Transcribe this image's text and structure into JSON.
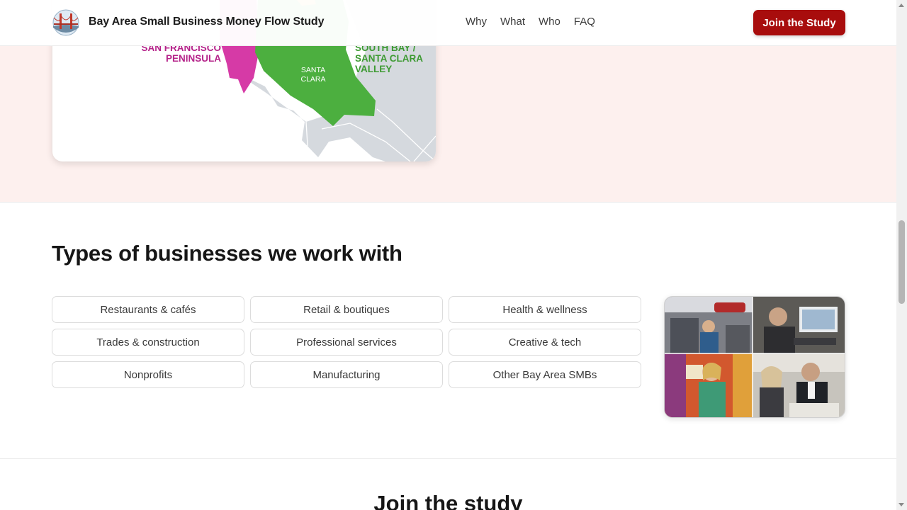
{
  "header": {
    "brand": "Bay Area Small Business Money Flow Study",
    "nav": [
      {
        "label": "Why"
      },
      {
        "label": "What"
      },
      {
        "label": "Who"
      },
      {
        "label": "FAQ"
      }
    ],
    "cta_label": "Join the Study",
    "colors": {
      "cta": "#a80d0d",
      "brand_text": "#1d1d1d"
    }
  },
  "map": {
    "labels": {
      "peninsula_line1": "SAN FRANCISCO",
      "peninsula_line2": "PENINSULA",
      "santa_clara_line1": "SANTA",
      "santa_clara_line2": "CLARA",
      "south_bay_line1": "SOUTH BAY /",
      "south_bay_line2": "SANTA CLARA",
      "south_bay_line3": "VALLEY"
    },
    "colors": {
      "peninsula": "#d63aa6",
      "south_bay": "#4caf3f",
      "land": "#d5d9de",
      "section_bg": "#fdf0ee"
    }
  },
  "business_types": {
    "title": "Types of businesses we work with",
    "items": [
      {
        "label": "Restaurants & cafés"
      },
      {
        "label": "Retail & boutiques"
      },
      {
        "label": "Health & wellness"
      },
      {
        "label": "Trades & construction"
      },
      {
        "label": "Professional services"
      },
      {
        "label": "Creative & tech"
      },
      {
        "label": "Nonprofits"
      },
      {
        "label": "Manufacturing"
      },
      {
        "label": "Other Bay Area SMBs"
      }
    ]
  },
  "join": {
    "title": "Join the study"
  }
}
